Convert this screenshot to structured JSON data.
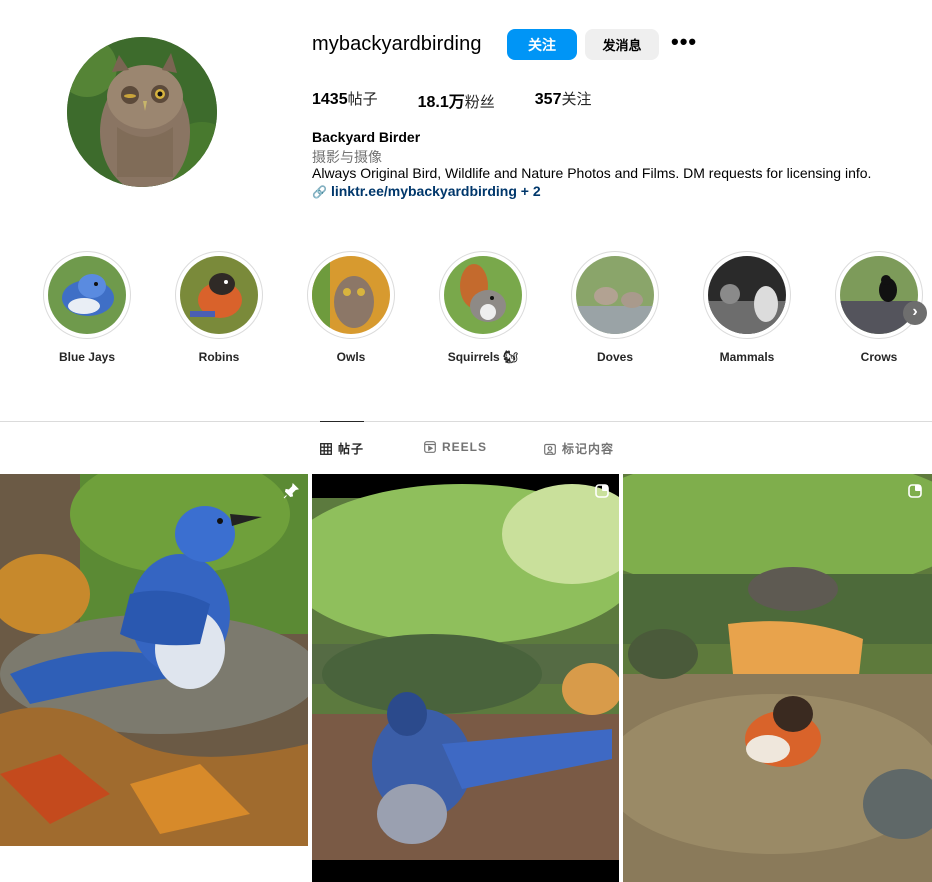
{
  "profile": {
    "username": "mybackyardbirding",
    "follow_label": "关注",
    "message_label": "发消息",
    "more_label": "•••",
    "stats": [
      {
        "value": "1435",
        "label": "帖子"
      },
      {
        "value": "18.1万",
        "label": "粉丝"
      },
      {
        "value": "357",
        "label": "关注"
      }
    ],
    "full_name": "Backyard Birder",
    "category": "摄影与摄像",
    "bio": "Always Original Bird, Wildlife and Nature Photos and Films. DM requests for licensing info.",
    "link_text": "linktr.ee/mybackyardbirding + 2"
  },
  "highlights": [
    {
      "label": "Blue Jays"
    },
    {
      "label": "Robins"
    },
    {
      "label": "Owls"
    },
    {
      "label": "Squirrels 🐿"
    },
    {
      "label": "Doves"
    },
    {
      "label": "Mammals"
    },
    {
      "label": "Crows"
    }
  ],
  "tabs": [
    {
      "label": "帖子",
      "icon": "grid-icon",
      "active": true
    },
    {
      "label": "REELS",
      "icon": "reels-icon",
      "active": false
    },
    {
      "label": "标记内容",
      "icon": "tagged-icon",
      "active": false
    }
  ],
  "posts": [
    {
      "subject": "blue jay bathing",
      "badge": "pin-icon"
    },
    {
      "subject": "blue jay bathing",
      "badge": "reel-icon"
    },
    {
      "subject": "towhee bathing",
      "badge": "reel-icon"
    }
  ],
  "colors": {
    "accent": "#0095f6",
    "link": "#00376b",
    "secondary_text": "#737373",
    "border": "#dbdbdb"
  }
}
